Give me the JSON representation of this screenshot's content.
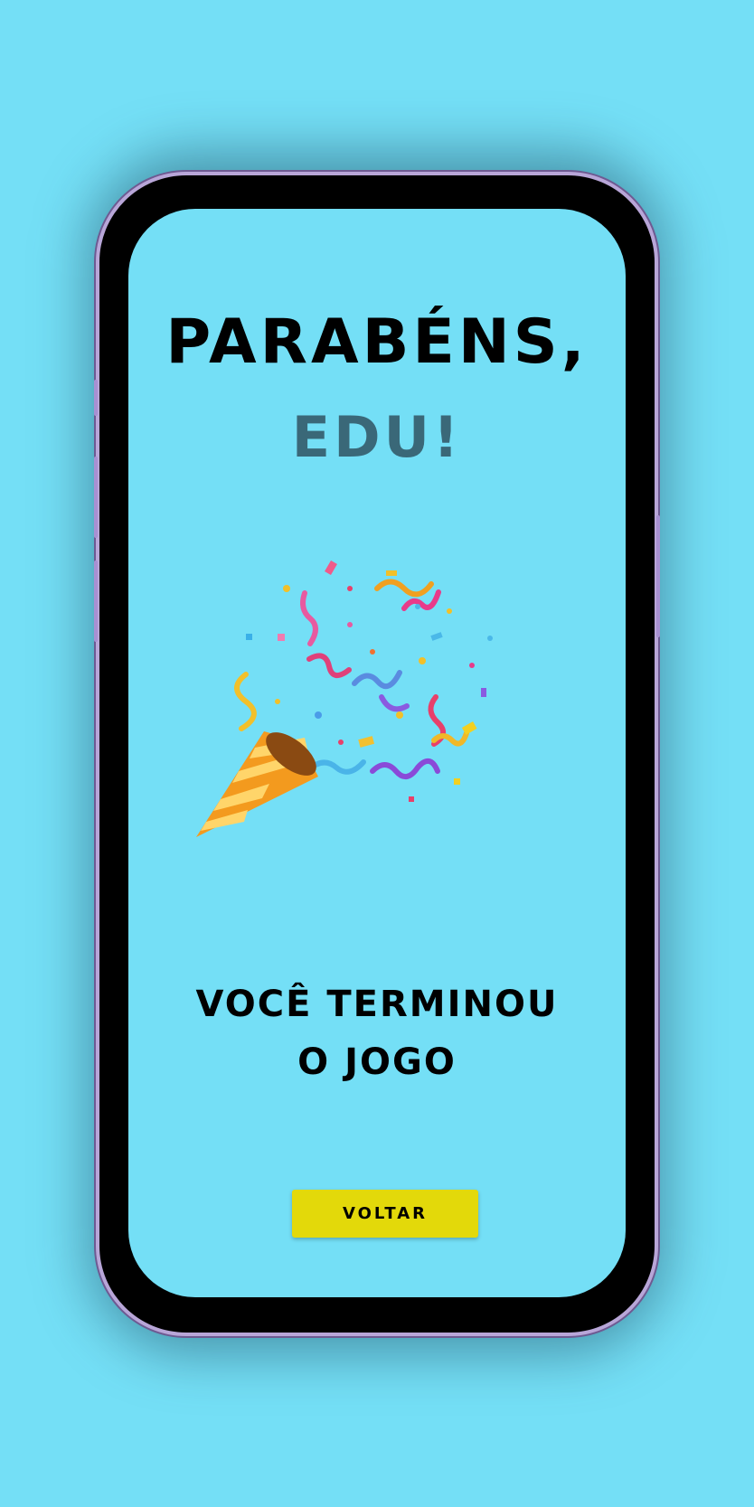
{
  "screen": {
    "title": "PARABÉNS,",
    "name": "EDU!",
    "message_line1": "VOCÊ TERMINOU",
    "message_line2": "O JOGO",
    "back_label": "VOLTAR",
    "illustration_icon": "party-popper-icon"
  },
  "colors": {
    "background": "#74dff6",
    "button": "#e3d90a",
    "name_text": "#3a6878"
  }
}
